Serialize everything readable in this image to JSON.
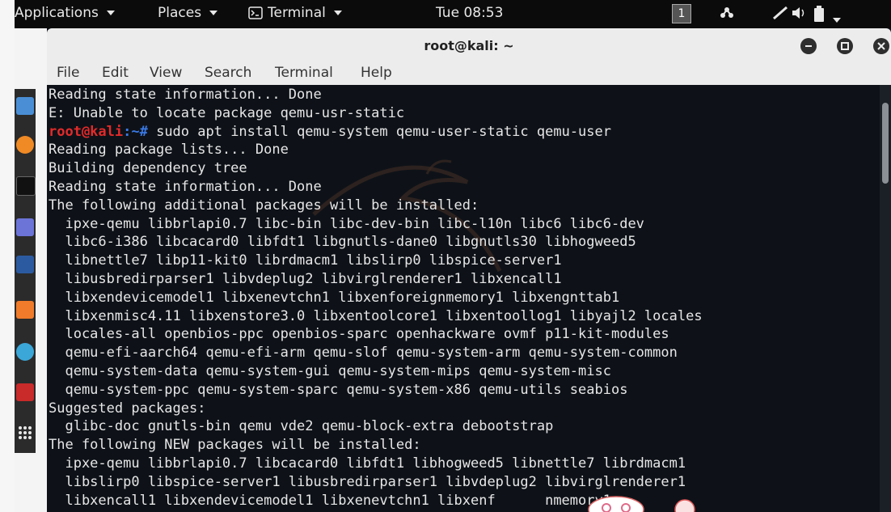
{
  "topbar": {
    "applications": "Applications",
    "places": "Places",
    "terminal": "Terminal",
    "clock": "Tue 08:53",
    "workspace": "1"
  },
  "window": {
    "title": "root@kali: ~",
    "menu": [
      "File",
      "Edit",
      "View",
      "Search",
      "Terminal",
      "Help"
    ]
  },
  "terminal": {
    "prompt_user": "root@kali",
    "prompt_path": ":~#",
    "command": " sudo apt install qemu-system qemu-user-static qemu-user",
    "lines_before": [
      "Reading state information... Done",
      "E: Unable to locate package qemu-usr-static"
    ],
    "lines_after": [
      "Reading package lists... Done",
      "Building dependency tree",
      "Reading state information... Done",
      "The following additional packages will be installed:",
      "  ipxe-qemu libbrlapi0.7 libc-bin libc-dev-bin libc-l10n libc6 libc6-dev",
      "  libc6-i386 libcacard0 libfdt1 libgnutls-dane0 libgnutls30 libhogweed5",
      "  libnettle7 libp11-kit0 librdmacm1 libslirp0 libspice-server1",
      "  libusbredirparser1 libvdeplug2 libvirglrenderer1 libxencall1",
      "  libxendevicemodel1 libxenevtchn1 libxenforeignmemory1 libxengnttab1",
      "  libxenmisc4.11 libxenstore3.0 libxentoolcore1 libxentoollog1 libyajl2 locales",
      "  locales-all openbios-ppc openbios-sparc openhackware ovmf p11-kit-modules",
      "  qemu-efi-aarch64 qemu-efi-arm qemu-slof qemu-system-arm qemu-system-common",
      "  qemu-system-data qemu-system-gui qemu-system-mips qemu-system-misc",
      "  qemu-system-ppc qemu-system-sparc qemu-system-x86 qemu-utils seabios",
      "Suggested packages:",
      "  glibc-doc gnutls-bin qemu vde2 qemu-block-extra debootstrap",
      "The following NEW packages will be installed:",
      "  ipxe-qemu libbrlapi0.7 libcacard0 libfdt1 libhogweed5 libnettle7 librdmacm1",
      "  libslirp0 libspice-server1 libusbredirparser1 libvdeplug2 libvirglrenderer1",
      "  libxencall1 libxendevicemodel1 libxenevtchn1 libxenf      nmemory1"
    ]
  },
  "colors": {
    "prompt_user": "#e32a2a",
    "prompt_path": "#3a79e6",
    "terminal_bg": "#0e1218",
    "terminal_fg": "#e6e6e6"
  },
  "icons": {
    "dock": [
      "files-icon",
      "firefox-icon",
      "terminal-icon",
      "text-editor-icon",
      "metasploit-icon",
      "burpsuite-icon",
      "eye-icon",
      "cherrytree-icon",
      "show-apps-icon"
    ]
  }
}
